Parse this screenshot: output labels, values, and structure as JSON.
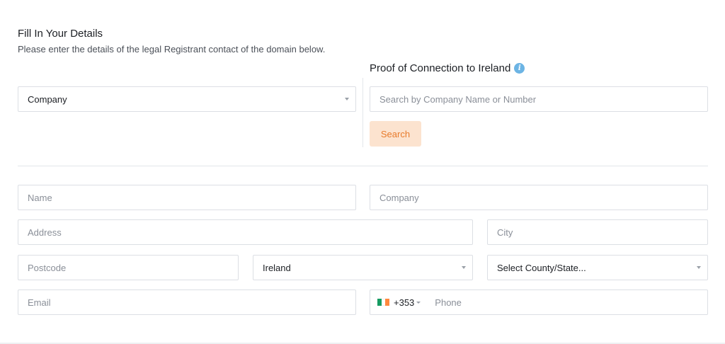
{
  "header": {
    "title": "Fill In Your Details",
    "subtitle": "Please enter the details of the legal Registrant contact of the domain below."
  },
  "proof": {
    "heading": "Proof of Connection to Ireland",
    "info_icon": "i",
    "search_placeholder": "Search by Company Name or Number",
    "search_button": "Search"
  },
  "registrant_type": {
    "selected": "Company"
  },
  "form": {
    "name_placeholder": "Name",
    "company_placeholder": "Company",
    "address_placeholder": "Address",
    "city_placeholder": "City",
    "postcode_placeholder": "Postcode",
    "country_selected": "Ireland",
    "county_selected": "Select County/State...",
    "email_placeholder": "Email",
    "phone_code": "+353",
    "phone_placeholder": "Phone"
  },
  "colors": {
    "accent_orange": "#e87b2c",
    "button_bg": "#fce3cf",
    "info_blue": "#6cb4e4",
    "flag_green": "#169b62",
    "flag_white": "#ffffff",
    "flag_orange": "#ff883e"
  }
}
